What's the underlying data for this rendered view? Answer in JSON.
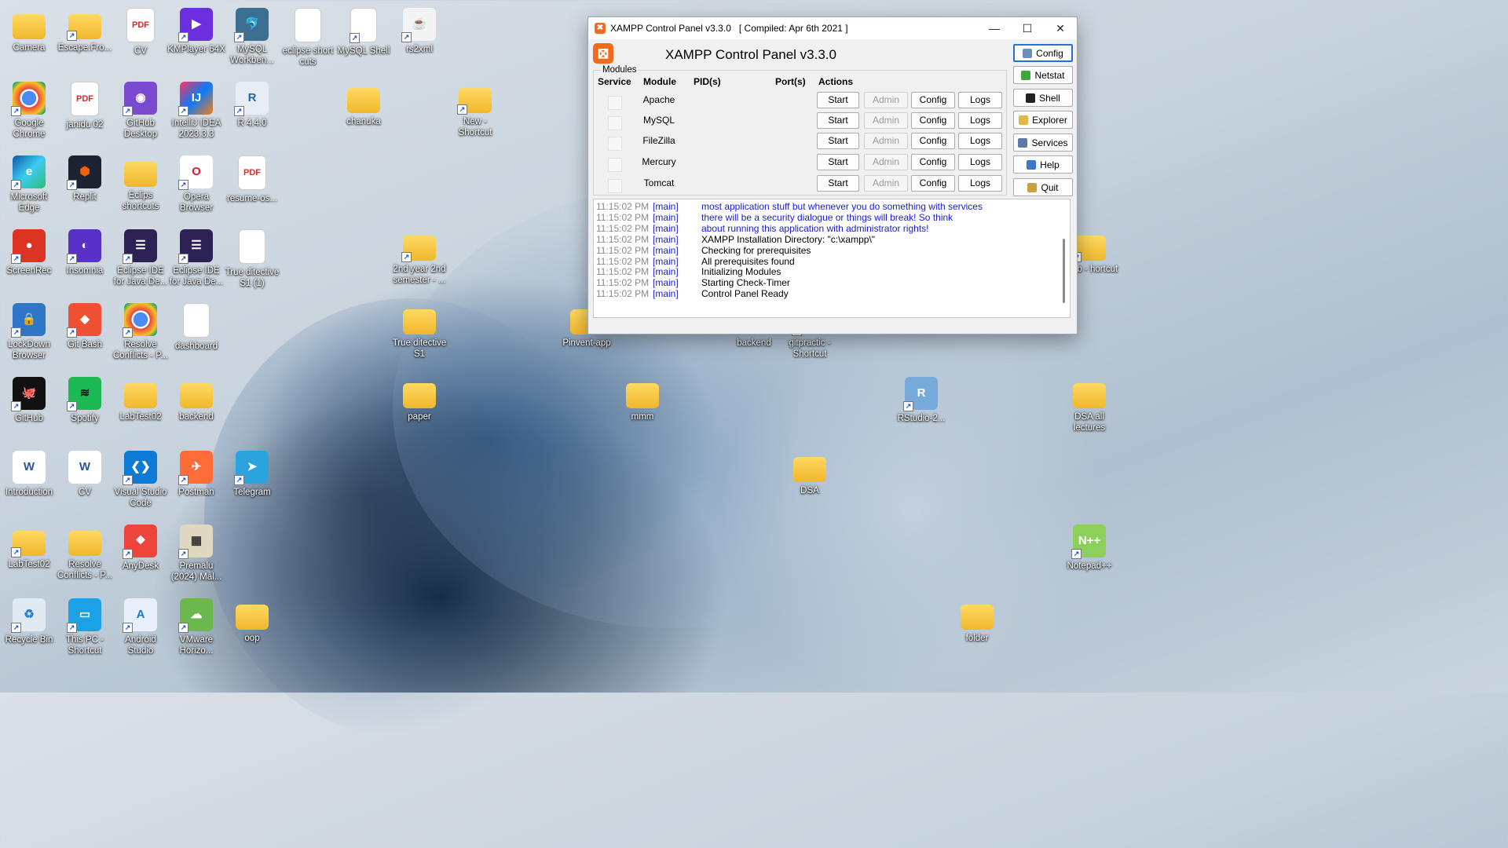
{
  "colors": {
    "xampp_orange": "#f26b1d",
    "log_blue": "#1a1ad1",
    "log_gray": "#8a8a8a",
    "focus_blue": "#2a6fd6"
  },
  "desktop_icons": [
    {
      "label": "Camera",
      "icon": "folder-icon"
    },
    {
      "label": "Escape.Fro...",
      "icon": "zip-folder-icon"
    },
    {
      "label": "CV",
      "icon": "pdf-icon"
    },
    {
      "label": "KMPlayer 64X",
      "icon": "kmplayer-icon"
    },
    {
      "label": "MySQL Workben...",
      "icon": "mysql-workbench-icon"
    },
    {
      "label": "eclipse short cuts",
      "icon": "text-file-icon"
    },
    {
      "label": "MySQL Shell",
      "icon": "file-icon"
    },
    {
      "label": "rs2xml",
      "icon": "java-icon"
    },
    {
      "label": "Google Chrome",
      "icon": "chrome-icon"
    },
    {
      "label": "janidu 02",
      "icon": "pdf-icon"
    },
    {
      "label": "GitHub Desktop",
      "icon": "github-desktop-icon"
    },
    {
      "label": "IntelliJ IDEA 2023.3.3",
      "icon": "intellij-icon"
    },
    {
      "label": "R 4.4.0",
      "icon": "r-icon"
    },
    {
      "label": "chanuka",
      "icon": "folder-icon"
    },
    {
      "label": "New - Shortcut",
      "icon": "folder-icon"
    },
    {
      "label": "Microsoft Edge",
      "icon": "edge-icon"
    },
    {
      "label": "Replit",
      "icon": "replit-icon"
    },
    {
      "label": "Eclips shortcuts",
      "icon": "folder-icon"
    },
    {
      "label": "Opera Browser",
      "icon": "opera-icon"
    },
    {
      "label": "resume-os...",
      "icon": "pdf-icon"
    },
    {
      "label": "ScreenRec",
      "icon": "screenrec-icon"
    },
    {
      "label": "Insomnia",
      "icon": "insomnia-icon"
    },
    {
      "label": "Eclipse IDE for Java De...",
      "icon": "eclipse-icon"
    },
    {
      "label": "Eclipse IDE for Java De...",
      "icon": "eclipse-icon"
    },
    {
      "label": "True ditective S1 (1)",
      "icon": "file-icon"
    },
    {
      "label": "2nd year 2nd semester - ...",
      "icon": "folder-icon"
    },
    {
      "label": "LockDown Browser",
      "icon": "lockdown-icon"
    },
    {
      "label": "Git Bash",
      "icon": "git-icon"
    },
    {
      "label": "Resolve Conflicts - P...",
      "icon": "chrome-icon"
    },
    {
      "label": "dashboard",
      "icon": "file-icon"
    },
    {
      "label": "True ditective S1",
      "icon": "folder-icon"
    },
    {
      "label": "Pinvent-app",
      "icon": "folder-icon"
    },
    {
      "label": "backend",
      "icon": "folder-icon"
    },
    {
      "label": "gitpractic - Shortcut",
      "icon": "folder-icon"
    },
    {
      "label": "itHub - hortcut",
      "icon": "folder-icon"
    },
    {
      "label": "GitHub",
      "icon": "github-icon"
    },
    {
      "label": "Spotify",
      "icon": "spotify-icon"
    },
    {
      "label": "LabTest02",
      "icon": "folder-icon"
    },
    {
      "label": "backend",
      "icon": "folder-icon"
    },
    {
      "label": "paper",
      "icon": "folder-icon"
    },
    {
      "label": "mmm",
      "icon": "folder-icon"
    },
    {
      "label": "RStudio-2...",
      "icon": "rstudio-icon"
    },
    {
      "label": "DSA all lectures",
      "icon": "folder-icon"
    },
    {
      "label": "Introduction",
      "icon": "word-icon"
    },
    {
      "label": "CV",
      "icon": "word-icon"
    },
    {
      "label": "Visual Studio Code",
      "icon": "vscode-icon"
    },
    {
      "label": "Postman",
      "icon": "postman-icon"
    },
    {
      "label": "Telegram",
      "icon": "telegram-icon"
    },
    {
      "label": "DSA",
      "icon": "folder-icon"
    },
    {
      "label": "LabTest02",
      "icon": "zip-folder-icon"
    },
    {
      "label": "Resolve Conflicts - P...",
      "icon": "folder-icon"
    },
    {
      "label": "AnyDesk",
      "icon": "anydesk-icon"
    },
    {
      "label": "Premalu (2024) Mal...",
      "icon": "video-icon"
    },
    {
      "label": "Notepad++",
      "icon": "notepadpp-icon"
    },
    {
      "label": "Recycle Bin",
      "icon": "recycle-bin-icon"
    },
    {
      "label": "This PC - Shortcut",
      "icon": "this-pc-icon"
    },
    {
      "label": "Android Studio",
      "icon": "android-studio-icon"
    },
    {
      "label": "VMware Horizo...",
      "icon": "vmware-icon"
    },
    {
      "label": "oop",
      "icon": "folder-icon"
    },
    {
      "label": "folder",
      "icon": "folder-icon"
    }
  ],
  "window": {
    "title": "XAMPP Control Panel v3.3.0   [ Compiled: Apr 6th 2021 ]",
    "minimize": "—",
    "maximize": "☐",
    "close": "✕",
    "header_title": "XAMPP Control Panel v3.3.0",
    "logo_glyph": "⊠",
    "modules_label": "Modules",
    "columns": {
      "service": "Service",
      "module": "Module",
      "pid": "PID(s)",
      "port": "Port(s)",
      "actions": "Actions"
    },
    "modules": [
      {
        "name": "Apache",
        "start": "Start",
        "admin": "Admin",
        "config": "Config",
        "logs": "Logs"
      },
      {
        "name": "MySQL",
        "start": "Start",
        "admin": "Admin",
        "config": "Config",
        "logs": "Logs"
      },
      {
        "name": "FileZilla",
        "start": "Start",
        "admin": "Admin",
        "config": "Config",
        "logs": "Logs"
      },
      {
        "name": "Mercury",
        "start": "Start",
        "admin": "Admin",
        "config": "Config",
        "logs": "Logs"
      },
      {
        "name": "Tomcat",
        "start": "Start",
        "admin": "Admin",
        "config": "Config",
        "logs": "Logs"
      }
    ],
    "side_buttons": [
      {
        "label": "Config",
        "icon": "wrench-icon"
      },
      {
        "label": "Netstat",
        "icon": "globe-icon"
      },
      {
        "label": "Shell",
        "icon": "terminal-icon"
      },
      {
        "label": "Explorer",
        "icon": "folder-icon"
      },
      {
        "label": "Services",
        "icon": "services-icon"
      },
      {
        "label": "Help",
        "icon": "help-icon"
      },
      {
        "label": "Quit",
        "icon": "quit-icon"
      }
    ],
    "log": [
      {
        "time": "11:15:02 PM",
        "tag": "[main]",
        "text": "most application stuff but whenever you do something with services",
        "blue": true
      },
      {
        "time": "11:15:02 PM",
        "tag": "[main]",
        "text": "there will be a security dialogue or things will break! So think",
        "blue": true
      },
      {
        "time": "11:15:02 PM",
        "tag": "[main]",
        "text": "about running this application with administrator rights!",
        "blue": true
      },
      {
        "time": "11:15:02 PM",
        "tag": "[main]",
        "text": "XAMPP Installation Directory: \"c:\\xampp\\\"",
        "blue": false
      },
      {
        "time": "11:15:02 PM",
        "tag": "[main]",
        "text": "Checking for prerequisites",
        "blue": false
      },
      {
        "time": "11:15:02 PM",
        "tag": "[main]",
        "text": "All prerequisites found",
        "blue": false
      },
      {
        "time": "11:15:02 PM",
        "tag": "[main]",
        "text": "Initializing Modules",
        "blue": false
      },
      {
        "time": "11:15:02 PM",
        "tag": "[main]",
        "text": "Starting Check-Timer",
        "blue": false
      },
      {
        "time": "11:15:02 PM",
        "tag": "[main]",
        "text": "Control Panel Ready",
        "blue": false
      }
    ]
  }
}
